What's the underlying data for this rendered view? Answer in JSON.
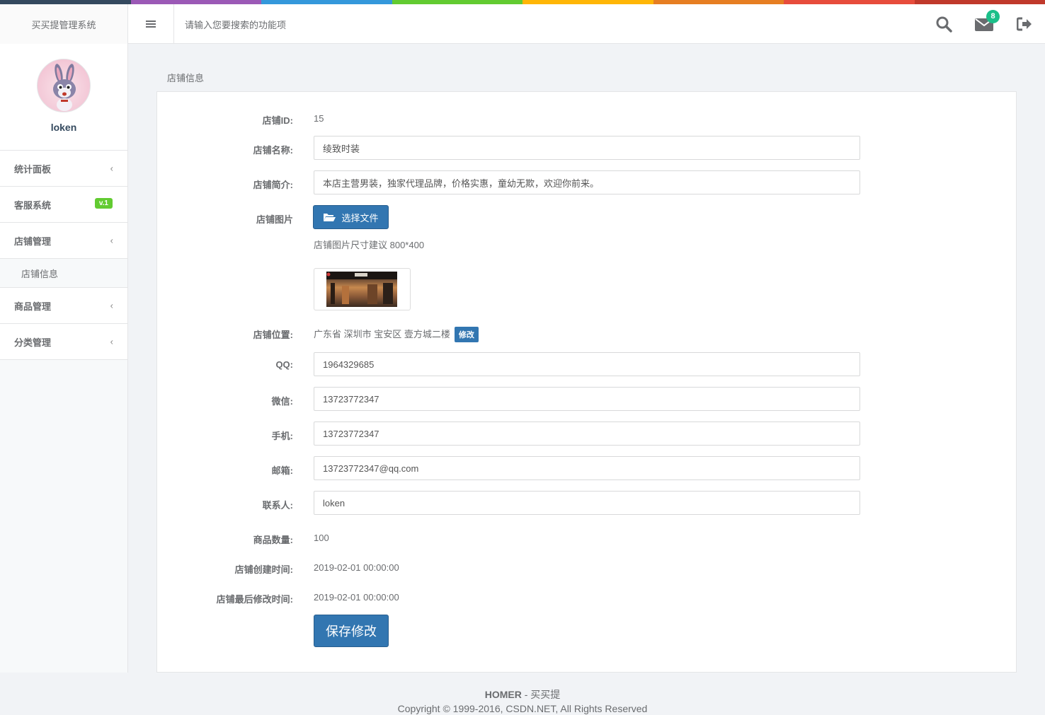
{
  "colors": {
    "strip": [
      "#34495e",
      "#9b59b6",
      "#3498db",
      "#62cb31",
      "#ffb606",
      "#e67e22",
      "#e74c3c",
      "#c0392b"
    ],
    "primary": "#3276b1",
    "success": "#62cb31",
    "badge": "#1bbf89"
  },
  "header": {
    "brand": "买买提管理系统",
    "menu_icon": "hamburger-icon",
    "search_placeholder": "请输入您要搜索的功能项",
    "icons": [
      "search-icon",
      "envelope-icon",
      "sign-out-icon"
    ],
    "mail_count": "8"
  },
  "sidebar": {
    "username": "loken",
    "items": [
      {
        "label": "统计面板",
        "arrow": "‹"
      },
      {
        "label": "客服系统",
        "badge": "v.1"
      },
      {
        "label": "店铺管理",
        "arrow": "‹"
      },
      {
        "label": "商品管理",
        "arrow": "‹"
      },
      {
        "label": "分类管理",
        "arrow": "‹"
      }
    ],
    "sub_item": "店铺信息"
  },
  "page": {
    "title": "店铺信息"
  },
  "form": {
    "shop_id_label": "店铺ID:",
    "shop_id": "15",
    "name_label": "店铺名称:",
    "name": "绫致时装",
    "intro_label": "店铺简介:",
    "intro": "本店主营男装，独家代理品牌，价格实惠，童幼无欺，欢迎你前来。",
    "image_label": "店铺图片",
    "file_button": "选择文件",
    "image_hint": "店铺图片尺寸建议 800*400",
    "location_label": "店铺位置:",
    "location": "广东省 深圳市 宝安区 壹方城二楼",
    "location_edit": "修改",
    "qq_label": "QQ:",
    "qq": "1964329685",
    "wechat_label": "微信:",
    "wechat": "13723772347",
    "phone_label": "手机:",
    "phone": "13723772347",
    "email_label": "邮箱:",
    "email": "13723772347@qq.com",
    "contact_label": "联系人:",
    "contact": "loken",
    "goods_count_label": "商品数量:",
    "goods_count": "100",
    "created_label": "店铺创建时间:",
    "created": "2019-02-01 00:00:00",
    "modified_label": "店铺最后修改时间:",
    "modified": "2019-02-01 00:00:00",
    "save_button": "保存修改"
  },
  "footer": {
    "brand": "HOMER",
    "brand_suffix": " - 买买提",
    "copyright": "Copyright © 1999-2016, CSDN.NET, All Rights Reserved"
  }
}
